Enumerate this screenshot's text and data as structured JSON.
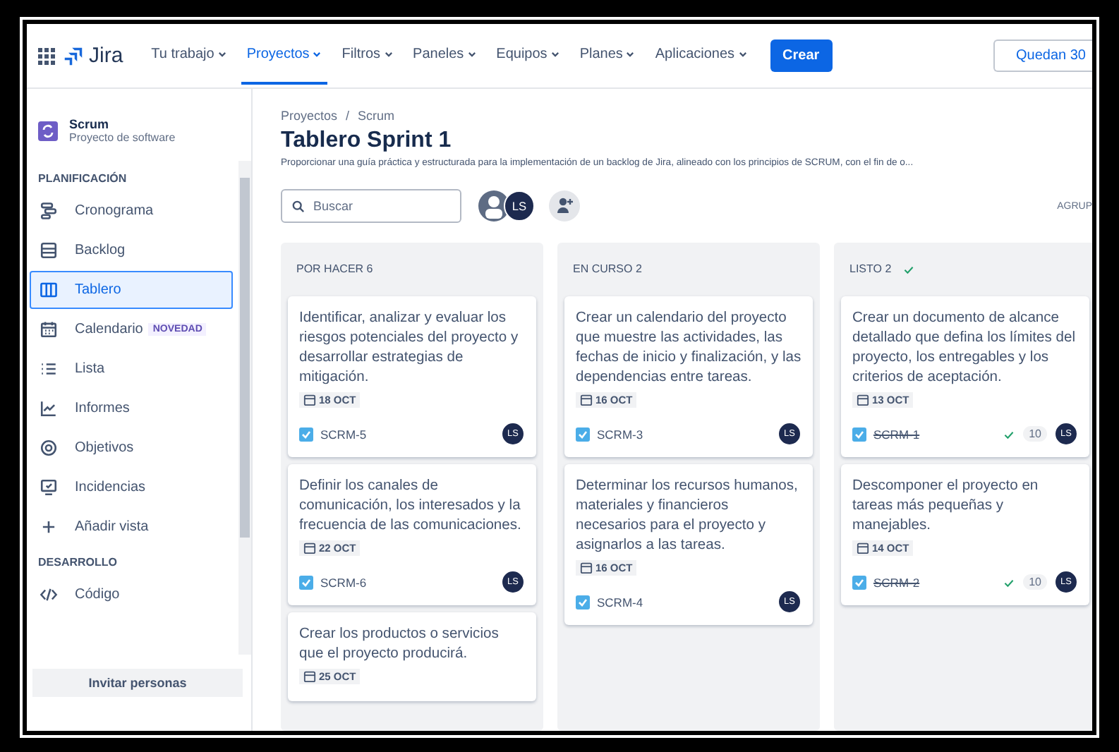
{
  "nav": {
    "logo": "Jira",
    "menu": [
      {
        "label": "Tu trabajo",
        "selected": false
      },
      {
        "label": "Proyectos",
        "selected": true
      },
      {
        "label": "Filtros",
        "selected": false
      },
      {
        "label": "Paneles",
        "selected": false
      },
      {
        "label": "Equipos",
        "selected": false
      },
      {
        "label": "Planes",
        "selected": false
      },
      {
        "label": "Aplicaciones",
        "selected": false
      }
    ],
    "create": "Crear",
    "trial": "Quedan 30"
  },
  "sidebar": {
    "project": {
      "name": "Scrum",
      "type": "Proyecto de software"
    },
    "sections": [
      {
        "heading": "PLANIFICACIÓN",
        "items": [
          {
            "label": "Cronograma",
            "kind": "timeline",
            "selected": false
          },
          {
            "label": "Backlog",
            "kind": "backlog",
            "selected": false
          },
          {
            "label": "Tablero",
            "kind": "board",
            "selected": true
          },
          {
            "label": "Calendario",
            "kind": "calendar",
            "selected": false,
            "badge": "NOVEDAD"
          },
          {
            "label": "Lista",
            "kind": "list",
            "selected": false
          },
          {
            "label": "Informes",
            "kind": "chart",
            "selected": false
          },
          {
            "label": "Objetivos",
            "kind": "target",
            "selected": false
          },
          {
            "label": "Incidencias",
            "kind": "monitor",
            "selected": false
          },
          {
            "label": "Añadir vista",
            "kind": "plus",
            "selected": false
          }
        ]
      },
      {
        "heading": "DESARROLLO",
        "items": [
          {
            "label": "Código",
            "kind": "code",
            "selected": false
          }
        ]
      }
    ],
    "invite": "Invitar personas"
  },
  "main": {
    "breadcrumb": {
      "separator": "/",
      "items": [
        "Proyectos",
        "Scrum"
      ]
    },
    "title": "Tablero Sprint 1",
    "description": "Proporcionar una guía práctica y estructurada para la implementación de un backlog de Jira, alineado con los principios de SCRUM, con el fin de o...",
    "search": {
      "placeholder": "Buscar"
    },
    "avatars": [
      {
        "kind": "generic"
      },
      {
        "kind": "initials",
        "initials": "LS"
      }
    ],
    "group_label": "AGRUP"
  },
  "columns": [
    {
      "title": "POR HACER 6",
      "complete": false,
      "cards": [
        {
          "summary": "Identificar, analizar y evaluar los riesgos potenciales del proyecto y desarrollar estrategias de mitigación.",
          "date": "18 OCT",
          "key": "SCRM-5",
          "done": false,
          "assignee": "LS"
        },
        {
          "summary": "Definir los canales de comunicación, los interesados y la frecuencia de las comunicaciones.",
          "date": "22 OCT",
          "key": "SCRM-6",
          "done": false,
          "assignee": "LS"
        },
        {
          "summary": "Crear los productos o servicios que el proyecto producirá.",
          "date": "25 OCT"
        }
      ]
    },
    {
      "title": "EN CURSO 2",
      "complete": false,
      "cards": [
        {
          "summary": "Crear un calendario del proyecto que muestre las actividades, las fechas de inicio y finalización, y las dependencias entre tareas.",
          "date": "16 OCT",
          "key": "SCRM-3",
          "done": false,
          "assignee": "LS"
        },
        {
          "summary": "Determinar los recursos humanos, materiales y financieros necesarios para el proyecto y asignarlos a las tareas.",
          "date": "16 OCT",
          "key": "SCRM-4",
          "done": false,
          "assignee": "LS"
        }
      ]
    },
    {
      "title": "LISTO 2",
      "complete": true,
      "cards": [
        {
          "summary": "Crear un documento de alcance detallado que defina los límites del proyecto, los entregables y los criterios de aceptación.",
          "date": "13 OCT",
          "key": "SCRM-1",
          "done": true,
          "estimate": "10",
          "assignee": "LS"
        },
        {
          "summary": "Descomponer el proyecto en tareas más pequeñas y manejables.",
          "date": "14 OCT",
          "key": "SCRM-2",
          "done": true,
          "estimate": "10",
          "assignee": "LS"
        }
      ]
    }
  ]
}
